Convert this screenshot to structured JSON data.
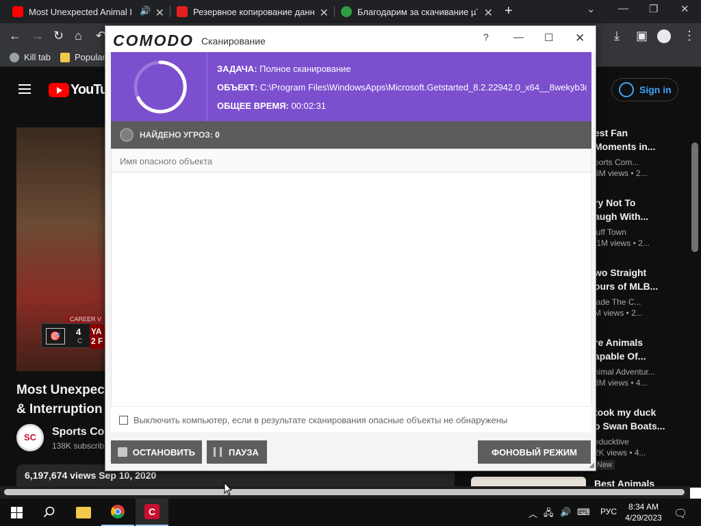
{
  "browser": {
    "tabs": [
      {
        "title": "Most Unexpected Animal Int",
        "favicon_color": "#ff0000"
      },
      {
        "title": "Резервное копирование данны",
        "favicon_color": "#e62020"
      },
      {
        "title": "Благодарим за скачивание µTorr",
        "favicon_color": "#2e9d45"
      }
    ],
    "bookmarks": [
      {
        "label": "Kill tab",
        "icon_color": "#9aa0a6"
      },
      {
        "label": "Popular",
        "icon_color": "#f2c94c"
      }
    ]
  },
  "youtube": {
    "logo_text": "YouTube",
    "signin": "Sign in",
    "video": {
      "career_banner": "CAREER V",
      "score": "4",
      "score_sub": "C",
      "team": "YA",
      "team_sub": "2 F",
      "title_line1": "Most Unexpecte",
      "title_line2": "& Interruption",
      "channel": "Sports Com",
      "subs": "138K subscrib",
      "views": "6,197,674 views  Sep 10, 2020"
    },
    "recommendations": [
      {
        "title1": "est Fan",
        "title2": "Moments in...",
        "channel": "ports Com...",
        "meta": "8M views  • 2..."
      },
      {
        "title1": "ry Not To",
        "title2": "augh With...",
        "channel": "luff Town",
        "meta": ".1M views  • 2..."
      },
      {
        "title1": "wo Straight",
        "title2": "ours of MLB...",
        "channel": "lade The C...",
        "meta": "M views  • 2..."
      },
      {
        "title1": "re Animals",
        "title2": "apable Of...",
        "channel": "nimal Adventur...",
        "meta": "3M views  • 4..."
      },
      {
        "title1": "took my duck",
        "title2": "o Swan Boats...",
        "channel": "educktive",
        "meta": "2K views  • 4...",
        "badge": "New"
      },
      {
        "title1": "Best Animals",
        "title2": "",
        "channel": "",
        "meta": ""
      }
    ]
  },
  "comodo": {
    "logo": "COMODO",
    "caption": "Сканирование",
    "help": "?",
    "task_label": "ЗАДАЧА:",
    "task_value": "Полное сканирование",
    "object_label": "ОБЪЕКТ:",
    "object_value": "C:\\Program Files\\WindowsApps\\Microsoft.Getstarted_8.2.22942.0_x64__8wekyb3d...",
    "time_label": "ОБЩЕЕ ВРЕМЯ:",
    "time_value": "00:02:31",
    "threats_label": "НАЙДЕНО УГРОЗ:",
    "threats_count": "0",
    "column_header": "Имя опасного объекта",
    "shutdown_label": "Выключить компьютер, если в результате сканирования опасные объекты не обнаружены",
    "stop_label": "ОСТАНОВИТЬ",
    "pause_label": "ПАУЗА",
    "background_label": "ФОНОВЫЙ РЕЖИМ",
    "accent_color": "#7c4fcf"
  },
  "taskbar": {
    "language": "РУС",
    "time": "8:34 AM",
    "date": "4/29/2023"
  }
}
